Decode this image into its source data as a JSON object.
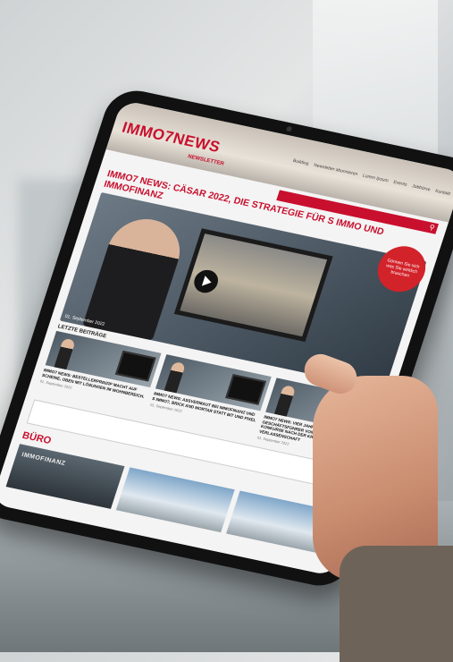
{
  "site": {
    "logo_text": "IMMO7NEWS",
    "tagline": "NEWSLETTER",
    "nav_items": [
      "Building",
      "Newsletter abonnieren",
      "Lorem Ipsum",
      "Events",
      "Jobbörse",
      "Kontakt"
    ],
    "search_icon": "search-icon"
  },
  "article": {
    "headline": "IMMO7 NEWS: CÄSAR 2022, DIE STRATEGIE FÜR S IMMO UND IMMOFINANZ",
    "date": "01. September 2022",
    "badge_text": "Gönnen Sie sich was Sie wirklich brauchen"
  },
  "latest": {
    "label": "LETZTE BEITRÄGE",
    "posts": [
      {
        "title": "IMMO7 NEWS: BESTELLERPRINZIP MACHT AUF SCHEINE, OBEN MIT LÖSUNGEN IM WOHNBEREICH.",
        "date": "01. September 2022"
      },
      {
        "title": "IMMO7 NEWS: ASSVERMAUT BEI IMMOFINANZ UND S IMMO?, BRICK AND MORTAR STATT BIT UND PIXEL",
        "date": "01. September 2022"
      },
      {
        "title": "IMMO7 NEWS: VIER JAHRE FÜR EX-GESCHÄFTSFÜHRER VON ONLINE-WERBEFIRMEN, KONKURSE NACH DER KRENSLER VERLASSENSCHAFT",
        "date": "01. September 2022"
      }
    ]
  },
  "buero": {
    "label": "BÜRO",
    "first_image_text": "IMMOFINANZ"
  }
}
